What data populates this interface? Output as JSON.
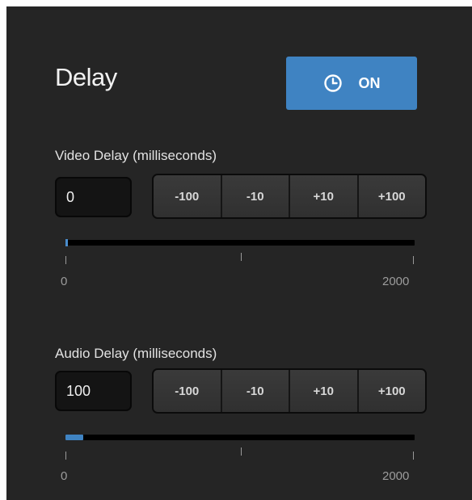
{
  "header": {
    "title": "Delay",
    "toggle_label": "ON",
    "toggle_icon": "clock-icon",
    "accent_color": "#3f83c2"
  },
  "video_delay": {
    "label": "Video Delay (milliseconds)",
    "value": "0",
    "buttons": [
      "-100",
      "-10",
      "+10",
      "+100"
    ],
    "slider": {
      "min_label": "0",
      "max_label": "2000",
      "min": 0,
      "max": 2000,
      "value": 0
    }
  },
  "audio_delay": {
    "label": "Audio Delay (milliseconds)",
    "value": "100",
    "buttons": [
      "-100",
      "-10",
      "+10",
      "+100"
    ],
    "slider": {
      "min_label": "0",
      "max_label": "2000",
      "min": 0,
      "max": 2000,
      "value": 100
    }
  }
}
